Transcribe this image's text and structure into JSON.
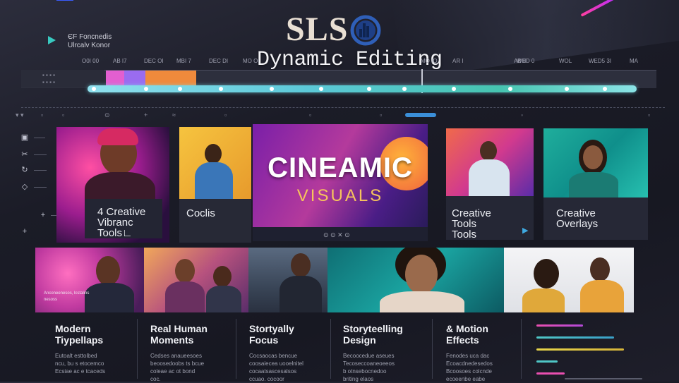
{
  "header": {
    "brand": "SLS",
    "subtitle": "Dynamic Editing",
    "app_line1": "ЄF Foncnedis",
    "app_line2": "Ulrcalv Konor"
  },
  "timeline": {
    "ruler": [
      "O0I 00",
      "AB I7",
      "DEC OI",
      "MBI 7",
      "DEC DI",
      "MO OI",
      "",
      "",
      "",
      "MO IO",
      "AR I",
      "",
      "AB II",
      "WED 0",
      "",
      "WED5 3I",
      "WOL",
      "MA"
    ]
  },
  "cards": {
    "c1_title": "4 Creative\nVibranc\nTools∟",
    "c2_title": "Coclis",
    "c3_line1": "CINEAMIC",
    "c3_line2": "VISUALS",
    "c4_title": "Creative\nTools\nTools",
    "c5_title": "Creative\nOverlays"
  },
  "strip": {
    "caption1": "Anconeenesos, lcstalins",
    "caption2": "nesoss"
  },
  "columns": [
    {
      "title": "Modern\nTiypellaps",
      "desc": "Eutoalt esttolbed\nncu, bu s etocemco\nEcsiae ac e tcaceds"
    },
    {
      "title": "Real Human\nMoments",
      "desc": "Cedses anaueesoes\nbeoosedoobs ts bcue\ncoleae ac ot bond\ncoc."
    },
    {
      "title": "Stortyally\nFocus",
      "desc": "Cocsaocas bencue\ncoosaiecea uooelnitel\ncocaatsascesalsos\nccuao. cocoor"
    },
    {
      "title": "Storyteelling\nDesign",
      "desc": "Becoocedue aseues\nTecoseccoaneoeeos\nb otnsebocnedoo\nbriting elaos"
    },
    {
      "title": "& Motion\nEffects",
      "desc": "Fenodes uca dac\nEcoacdnedesedos\nBcoosoes colcnde\necoeenbe eabe"
    }
  ],
  "colors": {
    "accent_teal": "#4fc6c6",
    "accent_pink": "#e94fb0",
    "accent_yellow": "#e7d54a"
  }
}
